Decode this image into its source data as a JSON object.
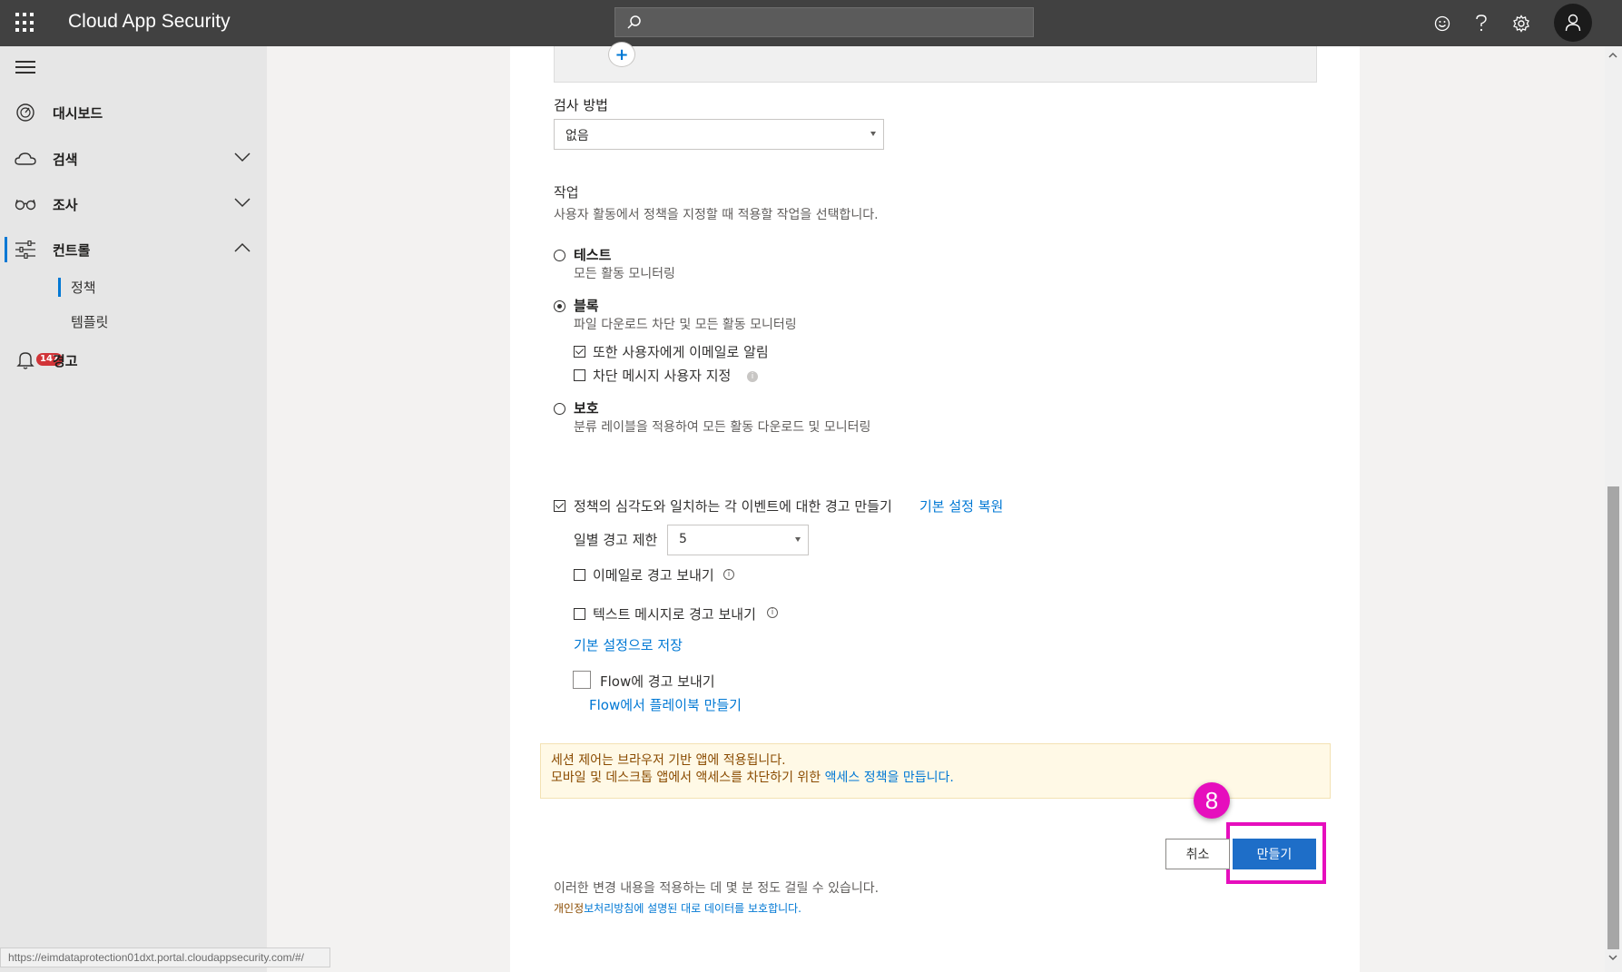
{
  "header": {
    "app_title": "Cloud App Security",
    "search_placeholder": ""
  },
  "icons": {
    "waffle": "app-launcher-icon",
    "search": "search-icon",
    "feedback": "smiley-icon",
    "help": "help-icon",
    "settings": "gear-icon",
    "account": "person-icon"
  },
  "sidebar": {
    "items": [
      {
        "label": "대시보드",
        "icon": "dashboard-icon"
      },
      {
        "label": "검색",
        "icon": "cloud-icon"
      },
      {
        "label": "조사",
        "icon": "glasses-icon"
      },
      {
        "label": "컨트롤",
        "icon": "sliders-icon"
      },
      {
        "label": "경고",
        "icon": "bell-icon",
        "badge": "147"
      }
    ],
    "control_sub": [
      "정책",
      "템플릿"
    ]
  },
  "form": {
    "inspection_label": "검사 방법",
    "inspection_value": "없음",
    "actions_title": "작업",
    "actions_desc": "사용자 활동에서 정책을 지정할 때 적용할 작업을 선택합니다.",
    "opt_test_title": "테스트",
    "opt_test_desc": "모든 활동 모니터링",
    "opt_block_title": "블록",
    "opt_block_desc": "파일 다운로드 차단 및 모든 활동 모니터링",
    "notify_email_label": "또한 사용자에게 이메일로 알림",
    "custom_block_label": "차단 메시지 사용자 지정",
    "opt_protect_title": "보호",
    "opt_protect_desc": "분류 레이블을 적용하여 모든 활동 다운로드 및 모니터링",
    "alert_label": "정책의 심각도와 일치하는 각 이벤트에 대한 경고 만들기",
    "restore_defaults": "기본 설정 복원",
    "daily_limit_label": "일별 경고 제한",
    "daily_limit_value": "5",
    "email_alert_label": "이메일로 경고 보내기",
    "sms_alert_label": "텍스트 메시지로 경고 보내기",
    "save_default": "기본 설정으로 저장",
    "flow_label": "Flow에 경고 보내기",
    "flow_playbook": "Flow에서 플레이북 만들기"
  },
  "notice": {
    "line1": "세션 제어는 브라우저 기반 앱에 적용됩니다.",
    "line2_prefix": "모바일 및 데스크톱 앱에서 액세스를 차단하기 위한 ",
    "line2_link": "액세스 정책을 만듭니다."
  },
  "buttons": {
    "cancel": "취소",
    "create": "만들기"
  },
  "step_badge": "8",
  "footer": {
    "note": "이러한 변경 내용을 적용하는 데 몇 분 정도 걸릴 수 있습니다.",
    "privacy_prefix": "개인정",
    "privacy_link": "보처리방침에 설명된 대로 데이터를 보호합니다."
  },
  "status_url": "https://eimdataprotection01dxt.portal.cloudappsecurity.com/#/",
  "colors": {
    "accent": "#0078d4",
    "highlight": "#e60ebd",
    "topbar": "#414141",
    "primary_button": "#1e6ec8",
    "alert_badge": "#d13438"
  }
}
